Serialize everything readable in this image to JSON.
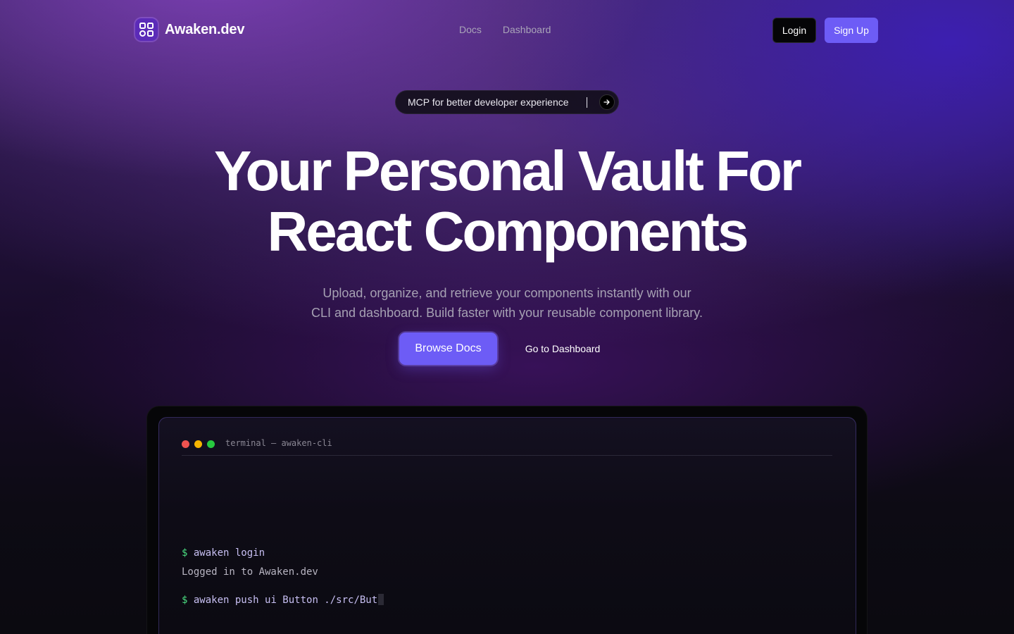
{
  "header": {
    "brand": "Awaken.dev",
    "nav": [
      "Docs",
      "Dashboard"
    ],
    "login_label": "Login",
    "signup_label": "Sign Up"
  },
  "announcement": {
    "text": "MCP for better developer experience"
  },
  "hero": {
    "title_line1": "Your Personal Vault For",
    "title_line2": "React Components",
    "subtitle_line1": "Upload, organize, and retrieve your components instantly with our",
    "subtitle_line2": "CLI and dashboard. Build faster with your reusable component library.",
    "primary_cta": "Browse Docs",
    "secondary_cta": "Go to Dashboard"
  },
  "terminal": {
    "title": "terminal — awaken-cli",
    "prompt": "$",
    "lines": [
      {
        "type": "command",
        "text": "awaken login"
      },
      {
        "type": "output",
        "text": "Logged in to Awaken.dev"
      },
      {
        "type": "command",
        "text": "awaken push ui Button ./src/But"
      }
    ]
  },
  "colors": {
    "accent": "#6d5cf6",
    "prompt_green": "#4ade80",
    "command_text": "#c7bff2"
  }
}
